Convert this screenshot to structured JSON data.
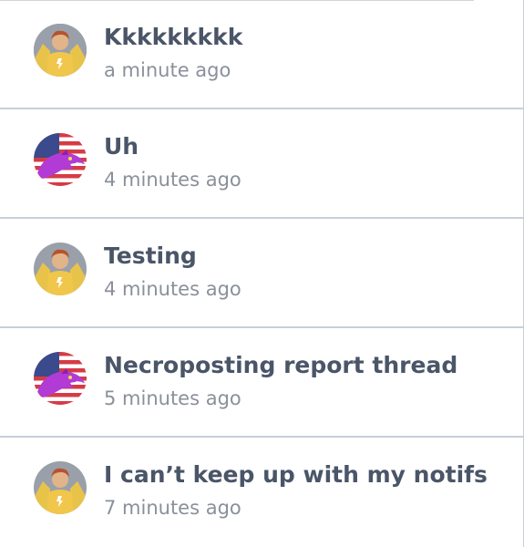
{
  "notifications": [
    {
      "title": "Kkkkkkkkk",
      "time": "a minute ago",
      "avatar": "hero-avatar-icon"
    },
    {
      "title": "Uh",
      "time": "4 minutes ago",
      "avatar": "flag-dragon-avatar-icon"
    },
    {
      "title": "Testing",
      "time": "4 minutes ago",
      "avatar": "hero-avatar-icon"
    },
    {
      "title": "Necroposting report thread",
      "time": "5 minutes ago",
      "avatar": "flag-dragon-avatar-icon"
    },
    {
      "title": "I can’t keep up with my notifs",
      "time": "7 minutes ago",
      "avatar": "hero-avatar-icon"
    }
  ],
  "colors": {
    "title": "#4a5568",
    "time": "#8a909a",
    "divider": "#c7cfda"
  }
}
